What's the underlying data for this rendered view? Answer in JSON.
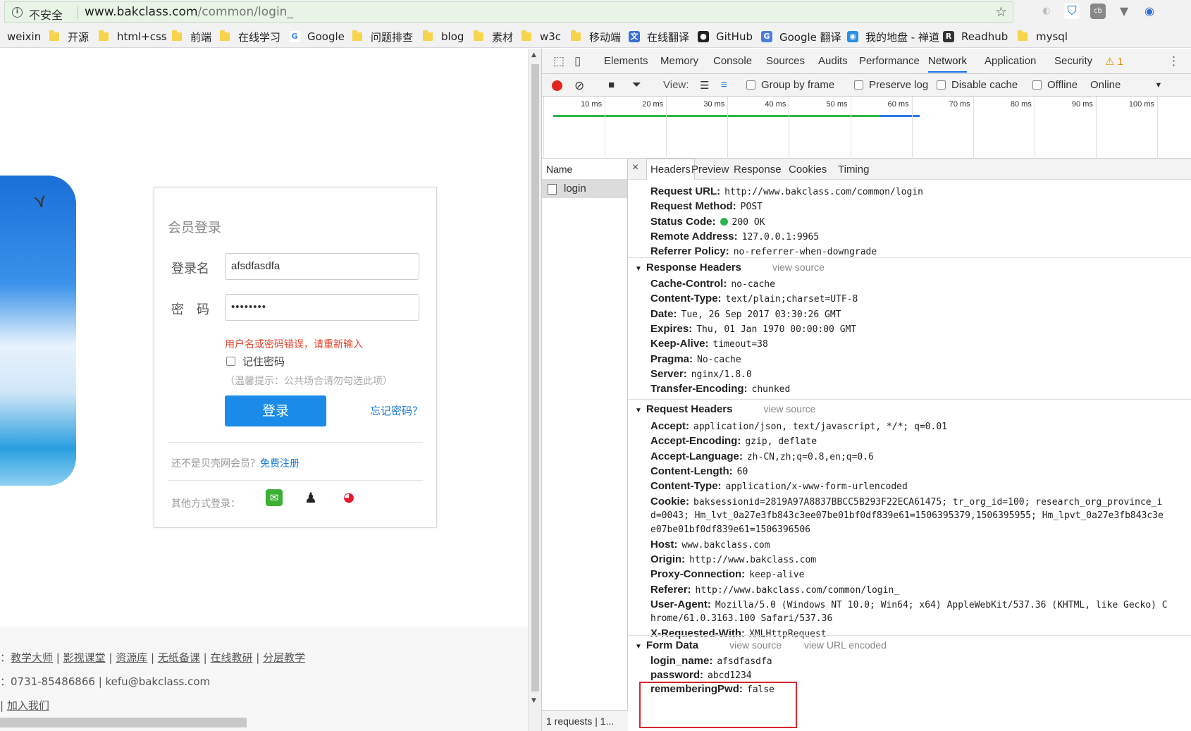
{
  "browser": {
    "security_label": "不安全",
    "url_host": "www.bakclass.com",
    "url_path": "/common/login_"
  },
  "bookmarks": [
    {
      "label": "weixin",
      "icon": "none"
    },
    {
      "label": "开源",
      "icon": "folder"
    },
    {
      "label": "html+css",
      "icon": "folder"
    },
    {
      "label": "前端",
      "icon": "folder"
    },
    {
      "label": "在线学习",
      "icon": "folder"
    },
    {
      "label": "Google",
      "icon": "google-icon"
    },
    {
      "label": "问题排查",
      "icon": "folder"
    },
    {
      "label": "blog",
      "icon": "folder"
    },
    {
      "label": "素材",
      "icon": "folder"
    },
    {
      "label": "w3c",
      "icon": "folder"
    },
    {
      "label": "移动端",
      "icon": "folder"
    },
    {
      "label": "在线翻译",
      "icon": "translate-icon"
    },
    {
      "label": "GitHub",
      "icon": "github-icon"
    },
    {
      "label": "Google 翻译",
      "icon": "google-translate-icon"
    },
    {
      "label": "我的地盘 - 禅道",
      "icon": "zentao-icon"
    },
    {
      "label": "Readhub",
      "icon": "readhub-icon"
    },
    {
      "label": "mysql",
      "icon": "folder"
    }
  ],
  "login": {
    "title": "会员登录",
    "username_label": "登录名",
    "username_value": "afsdfasdfa",
    "password_label": "密　码",
    "password_value": "••••••••",
    "error": "用户名或密码错误，请重新输入",
    "remember_label": "记住密码",
    "hint": "（温馨提示：公共场合请勿勾选此项）",
    "login_button": "登录",
    "forgot": "忘记密码？",
    "register_text": "还不是贝壳网会员？",
    "register_link": "免费注册",
    "other_login": "其他方式登录："
  },
  "footer": {
    "links_prefix": "：",
    "links": [
      "教学大师",
      "影视课堂",
      "资源库",
      "无纸备课",
      "在线教研",
      "分层教学"
    ],
    "contact": "：0731-85486866 | kefu@bakclass.com",
    "join": "加入我们"
  },
  "devtools": {
    "tabs": [
      "Elements",
      "Memory",
      "Console",
      "Sources",
      "Audits",
      "Performance",
      "Network",
      "Application",
      "Security"
    ],
    "active_tab": "Network",
    "warning_count": "1",
    "toolbar": {
      "view_label": "View:",
      "group_by_frame": "Group by frame",
      "preserve_log": "Preserve log",
      "disable_cache": "Disable cache",
      "offline": "Offline",
      "throttle": "Online"
    },
    "timeline_ticks": [
      "10 ms",
      "20 ms",
      "30 ms",
      "40 ms",
      "50 ms",
      "60 ms",
      "70 ms",
      "80 ms",
      "90 ms",
      "100 ms"
    ],
    "name_header": "Name",
    "request_name": "login",
    "status_bar": "1 requests | 1...",
    "detail_tabs": [
      "Headers",
      "Preview",
      "Response",
      "Cookies",
      "Timing"
    ],
    "general": [
      {
        "key": "Request URL:",
        "value": "http://www.bakclass.com/common/login"
      },
      {
        "key": "Request Method:",
        "value": "POST"
      },
      {
        "key": "Status Code:",
        "value": "200 OK"
      },
      {
        "key": "Remote Address:",
        "value": "127.0.0.1:9965"
      },
      {
        "key": "Referrer Policy:",
        "value": "no-referrer-when-downgrade"
      }
    ],
    "response_headers_title": "Response Headers",
    "view_source": "view source",
    "view_url_encoded": "view URL encoded",
    "response_headers": [
      {
        "key": "Cache-Control:",
        "value": "no-cache"
      },
      {
        "key": "Content-Type:",
        "value": "text/plain;charset=UTF-8"
      },
      {
        "key": "Date:",
        "value": "Tue, 26 Sep 2017 03:30:26 GMT"
      },
      {
        "key": "Expires:",
        "value": "Thu, 01 Jan 1970 00:00:00 GMT"
      },
      {
        "key": "Keep-Alive:",
        "value": "timeout=38"
      },
      {
        "key": "Pragma:",
        "value": "No-cache"
      },
      {
        "key": "Server:",
        "value": "nginx/1.8.0"
      },
      {
        "key": "Transfer-Encoding:",
        "value": "chunked"
      }
    ],
    "request_headers_title": "Request Headers",
    "request_headers": [
      {
        "key": "Accept:",
        "value": "application/json, text/javascript, */*; q=0.01"
      },
      {
        "key": "Accept-Encoding:",
        "value": "gzip, deflate"
      },
      {
        "key": "Accept-Language:",
        "value": "zh-CN,zh;q=0.8,en;q=0.6"
      },
      {
        "key": "Content-Length:",
        "value": "60"
      },
      {
        "key": "Content-Type:",
        "value": "application/x-www-form-urlencoded"
      },
      {
        "key": "Cookie:",
        "value": "baksessionid=2819A97A8837BBCC5B293F22ECA61475; tr_org_id=100; research_org_province_i"
      }
    ],
    "cookie_cont1": "d=0043; Hm_lvt_0a27e3fb843c3ee07be01bf0df839e61=1506395379,1506395955; Hm_lpvt_0a27e3fb843c3e",
    "cookie_cont2": "e07be01bf0df839e61=1506396506",
    "request_headers_2": [
      {
        "key": "Host:",
        "value": "www.bakclass.com"
      },
      {
        "key": "Origin:",
        "value": "http://www.bakclass.com"
      },
      {
        "key": "Proxy-Connection:",
        "value": "keep-alive"
      },
      {
        "key": "Referer:",
        "value": "http://www.bakclass.com/common/login_"
      },
      {
        "key": "User-Agent:",
        "value": "Mozilla/5.0 (Windows NT 10.0; Win64; x64) AppleWebKit/537.36 (KHTML, like Gecko) C"
      }
    ],
    "ua_cont": "hrome/61.0.3163.100 Safari/537.36",
    "x_requested_key": "X-Requested-With:",
    "x_requested_value": "XMLHttpRequest",
    "form_data_title": "Form Data",
    "form_data": [
      {
        "key": "login_name:",
        "value": "afsdfasdfa"
      },
      {
        "key": "password:",
        "value": "abcd1234"
      },
      {
        "key": "rememberingPwd:",
        "value": "false"
      }
    ]
  }
}
